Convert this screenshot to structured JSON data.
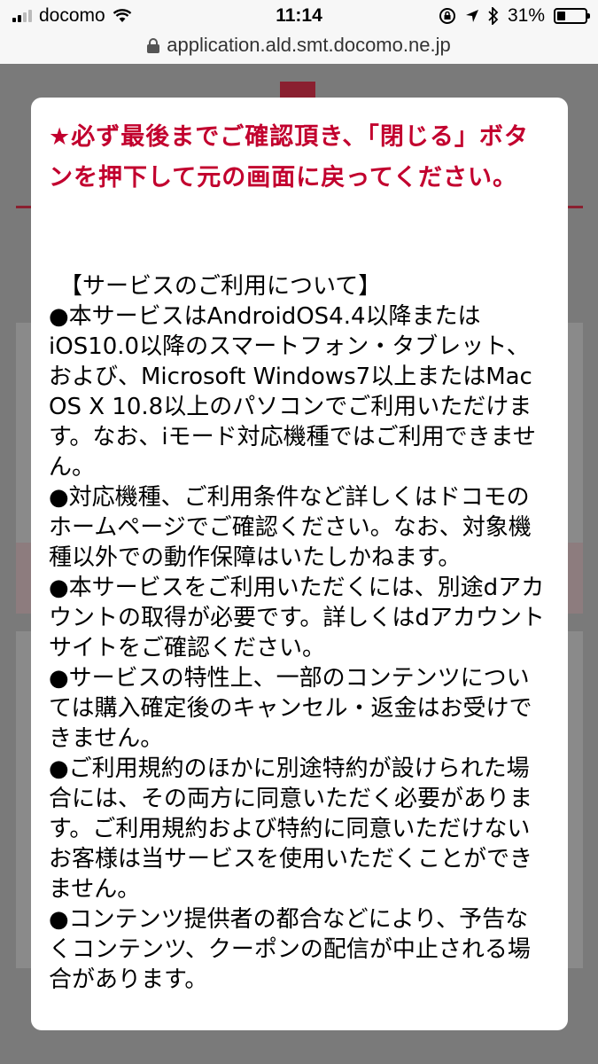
{
  "status_bar": {
    "carrier": "docomo",
    "time": "11:14",
    "battery_percent": "31%",
    "battery_level": 0.31,
    "icons": [
      "signal-icon",
      "wifi-icon",
      "rotation-lock-icon",
      "location-icon",
      "bluetooth-icon",
      "battery-icon"
    ]
  },
  "url_bar": {
    "url": "application.ald.smt.docomo.ne.jp"
  },
  "modal": {
    "warning": "★必ず最後までご確認頂き、「閉じる」ボタンを押下して元の画面に戻ってください。",
    "heading": "【サービスのご利用について】",
    "items": [
      "●本サービスはAndroidOS4.4以降またはiOS10.0以降のスマートフォン・タブレット、および、Microsoft Windows7以上またはMac OS X 10.8以上のパソコンでご利用いただけます。なお、iモード対応機種ではご利用できません。",
      "●対応機種、ご利用条件など詳しくはドコモのホームページでご確認ください。なお、対象機種以外での動作保障はいたしかねます。",
      "●本サービスをご利用いただくには、別途dアカウントの取得が必要です。詳しくはdアカウントサイトをご確認ください。",
      "●サービスの特性上、一部のコンテンツについては購入確定後のキャンセル・返金はお受けできません。",
      "●ご利用規約のほかに別途特約が設けられた場合には、その両方に同意いただく必要があります。ご利用規約および特約に同意いただけないお客様は当サービスを使用いただくことができません。",
      "●コンテンツ提供者の都合などにより、予告なくコンテンツ、クーポンの配信が中止される場合があります。"
    ]
  },
  "colors": {
    "warning_red": "#c2002e",
    "overlay": "#7a7a7a"
  }
}
